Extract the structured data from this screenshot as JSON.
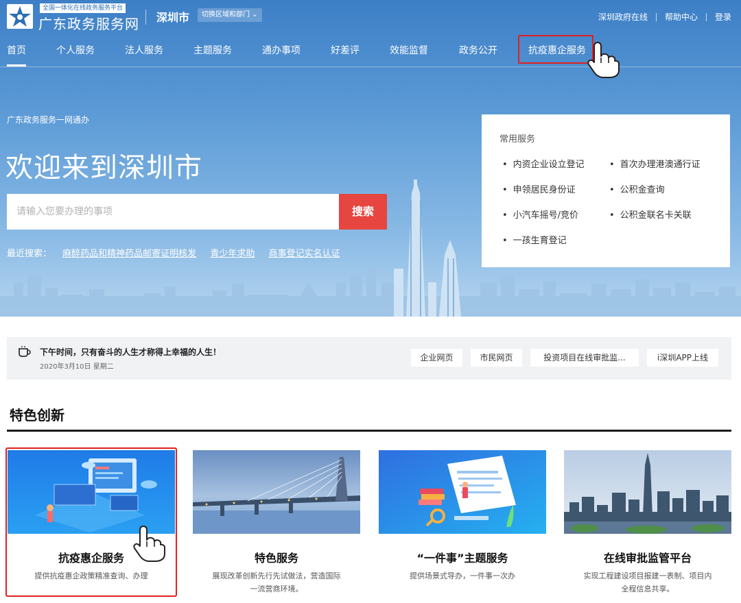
{
  "header": {
    "logo_small": "全国一体化在线政务服务平台",
    "logo_big": "广东政务服务网",
    "city": "深圳市",
    "switch_label": "切换区域和部门 ⌄",
    "links": [
      "深圳政府在线",
      "帮助中心",
      "登录"
    ]
  },
  "nav": {
    "items": [
      "首页",
      "个人服务",
      "法人服务",
      "主题服务",
      "通办事项",
      "好差评",
      "效能监督",
      "政务公开",
      "抗疫惠企服务"
    ],
    "active": "首页",
    "highlighted": "抗疫惠企服务"
  },
  "hero": {
    "tagline": "广东政务服务一网通办",
    "welcome": "欢迎来到深圳市",
    "search_placeholder": "请输入您要办理的事项",
    "search_button": "搜索",
    "recent_label": "最近搜索：",
    "recent": [
      "麻醉药品和精神药品邮寄证明核发",
      "青少年求助",
      "商事登记实名认证"
    ]
  },
  "common_services": {
    "title": "常用服务",
    "items": [
      "内资企业设立登记",
      "首次办理港澳通行证",
      "申领居民身份证",
      "公积金查询",
      "小汽车摇号/竞价",
      "公积金联名卡关联",
      "一孩生育登记"
    ]
  },
  "notice": {
    "message": "下午时间，只有奋斗的人生才称得上幸福的人生！",
    "date": "2020年3月10日 星期二",
    "links": [
      "企业网页",
      "市民网页",
      "投资项目在线审批监...",
      "i深圳APP上线"
    ]
  },
  "features": {
    "title": "特色创新",
    "cards": [
      {
        "title": "抗疫惠企服务",
        "desc": "提供抗疫惠企政策精准查询、办理",
        "image": "tech-illustration"
      },
      {
        "title": "特色服务",
        "desc": "展现改革创新先行先试做法，营造国际一流营商环境。",
        "image": "bridge-photo"
      },
      {
        "title": "“一件事”主题服务",
        "desc": "提供场景式导办，一件事一次办",
        "image": "documents-illustration"
      },
      {
        "title": "在线审批监管平台",
        "desc": "实现工程建设项目报建一表制、项目内全程信息共享。",
        "image": "city-photo"
      }
    ]
  },
  "colors": {
    "hero_top": "#3d7fc6",
    "search_button": "#e64540",
    "highlight_border": "#e02020"
  },
  "icons": [
    "logo-icon",
    "cup-icon",
    "pointing-hand-icon"
  ]
}
